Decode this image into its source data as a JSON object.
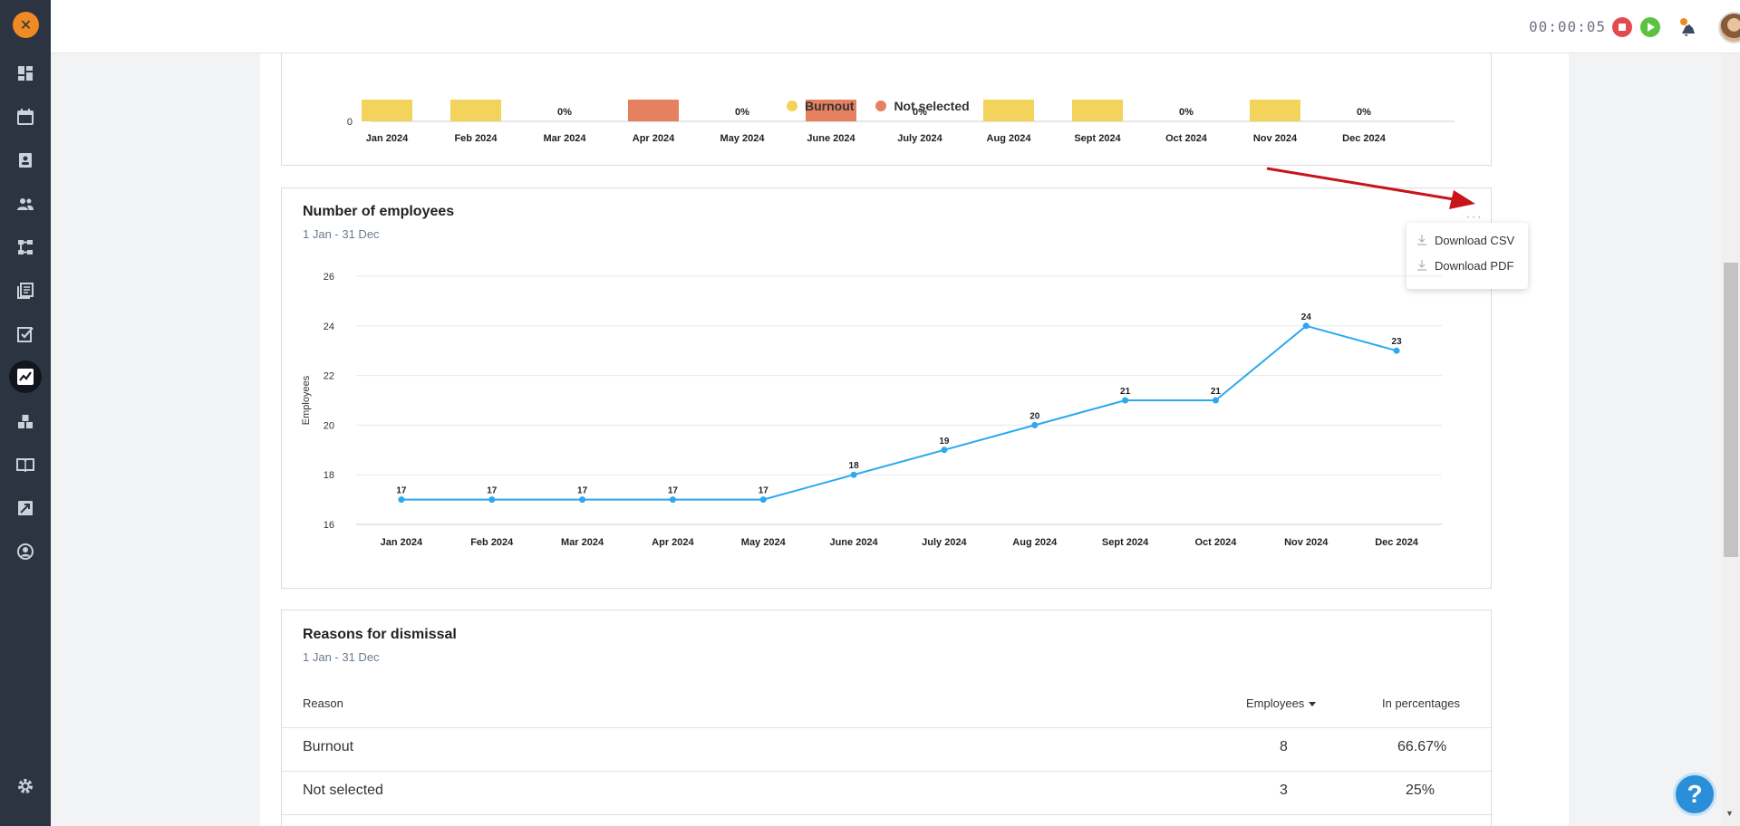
{
  "header": {
    "timer": "00:00:05"
  },
  "sidebar": {
    "logo_letter": "✕",
    "items": [
      {
        "icon": "dashboard-icon"
      },
      {
        "icon": "calendar-icon"
      },
      {
        "icon": "contacts-icon"
      },
      {
        "icon": "people-icon"
      },
      {
        "icon": "org-chart-icon"
      },
      {
        "icon": "documents-icon"
      },
      {
        "icon": "checklist-icon"
      },
      {
        "icon": "reports-icon",
        "active": true
      },
      {
        "icon": "boxes-icon"
      },
      {
        "icon": "book-icon"
      },
      {
        "icon": "trending-icon"
      },
      {
        "icon": "profile-icon"
      }
    ],
    "bottom_icon": "gear-icon"
  },
  "top_chart": {
    "categories": [
      "Jan 2024",
      "Feb 2024",
      "Mar 2024",
      "Apr 2024",
      "May 2024",
      "June 2024",
      "July 2024",
      "Aug 2024",
      "Sept 2024",
      "Oct 2024",
      "Nov 2024",
      "Dec 2024"
    ],
    "bar_colors": [
      "#f2d35b",
      "#f2d35b",
      null,
      "#e58160",
      null,
      "#e58160",
      null,
      "#f2d35b",
      "#f2d35b",
      null,
      "#f2d35b",
      null
    ],
    "zero_labels": [
      "",
      "",
      "0%",
      "",
      "0%",
      "",
      "0%",
      "",
      "",
      "0%",
      "",
      "0%"
    ],
    "y_tick": "0",
    "legend": [
      {
        "label": "Burnout",
        "color": "#f2d35b"
      },
      {
        "label": "Not selected",
        "color": "#e58160"
      }
    ]
  },
  "employees_card": {
    "title": "Number of employees",
    "subtitle": "1 Jan - 31 Dec",
    "menu": {
      "dots": "···",
      "items": [
        "Download CSV",
        "Download PDF"
      ]
    }
  },
  "chart_data": {
    "type": "line",
    "x": [
      "Jan 2024",
      "Feb 2024",
      "Mar 2024",
      "Apr 2024",
      "May 2024",
      "June 2024",
      "July 2024",
      "Aug 2024",
      "Sept 2024",
      "Oct 2024",
      "Nov 2024",
      "Dec 2024"
    ],
    "series": [
      {
        "values": [
          17,
          17,
          17,
          17,
          17,
          18,
          19,
          20,
          21,
          21,
          24,
          23
        ],
        "color": "#2ba8f0"
      }
    ],
    "title": "Number of employees",
    "subtitle": "1 Jan - 31 Dec",
    "xlabel": "",
    "ylabel": "Employees",
    "ylim": [
      16,
      26
    ],
    "yticks": [
      16,
      18,
      20,
      22,
      24,
      26
    ],
    "grid": true,
    "data_labels": true
  },
  "dismissal_card": {
    "title": "Reasons for dismissal",
    "subtitle": "1 Jan - 31 Dec",
    "columns": {
      "reason": "Reason",
      "employees": "Employees",
      "percent": "In percentages"
    },
    "rows": [
      {
        "reason": "Burnout",
        "employees": "8",
        "percent": "66.67%"
      },
      {
        "reason": "Not selected",
        "employees": "3",
        "percent": "25%"
      }
    ]
  },
  "help": {
    "label": "?"
  }
}
